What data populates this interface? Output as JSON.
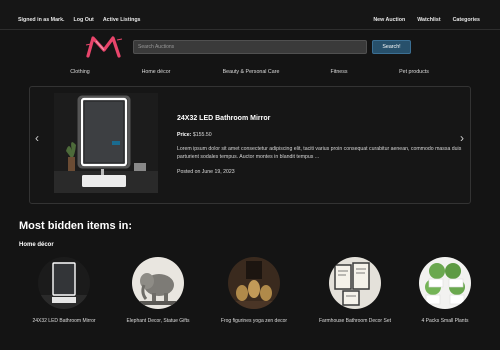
{
  "topnav": {
    "left": [
      "Signed in as Mark.",
      "Log Out",
      "Active Listings"
    ],
    "right": [
      "New Auction",
      "Watchlist",
      "Categories"
    ]
  },
  "search": {
    "placeholder": "Search Auctions",
    "button_label": "Search!"
  },
  "categories": [
    "Clothing",
    "Home décor",
    "Beauty & Personal Care",
    "Fitness",
    "Pet products"
  ],
  "featured": {
    "title": "24X32 LED Bathroom Mirror",
    "price_label": "Price:",
    "price": "$155.50",
    "description": "Lorem ipsum dolor sit amet consectetur adipiscing elit, taciti varius proin consequat curabitur aenean, commodo massa duis parturient sodales tempus. Auctor montes in blandit tempus ...",
    "date": "Posted on June 19, 2023",
    "prev_icon": "chevron-left-icon",
    "next_icon": "chevron-right-icon"
  },
  "most_bidden": {
    "title": "Most bidden items in:",
    "category": "Home décor",
    "items": [
      {
        "label": "24X32 LED Bathroom Mirror"
      },
      {
        "label": "Elephant Decor, Statue Gifts"
      },
      {
        "label": "Frog figurines yoga zen decor"
      },
      {
        "label": "Farmhouse Bathroom Decor Set"
      },
      {
        "label": "4 Packs Small Plants"
      }
    ]
  },
  "colors": {
    "background": "#141414",
    "accent": "#27506b",
    "logo": "#e8456b"
  }
}
